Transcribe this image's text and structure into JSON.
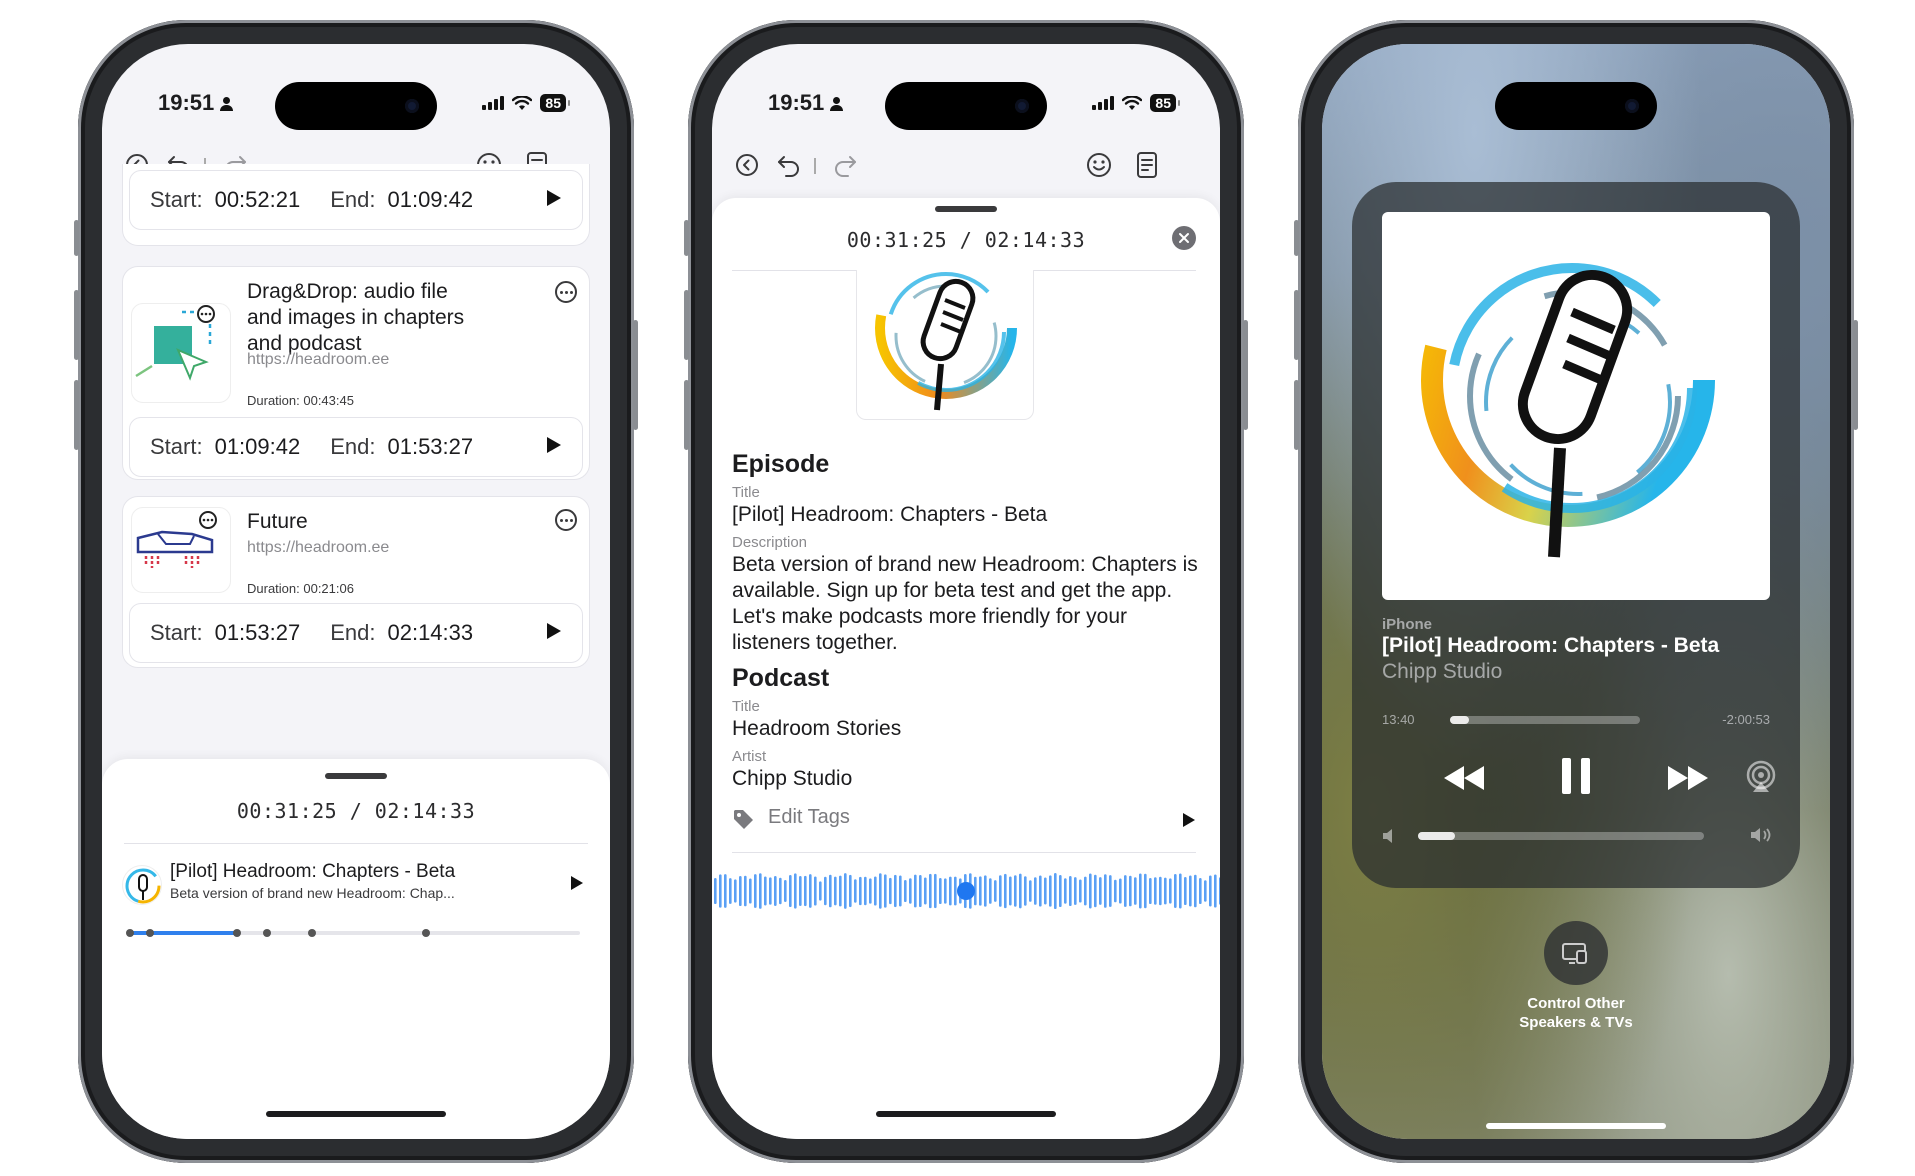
{
  "status": {
    "time": "19:51",
    "battery": "85"
  },
  "phone1": {
    "chapters": [
      {
        "start_label": "Start:",
        "start": "00:52:21",
        "end_label": "End:",
        "end": "01:09:42"
      },
      {
        "title": "Drag&Drop:  audio file and images in chapters and podcast",
        "url": "https://headroom.ee",
        "duration": "Duration: 00:43:45",
        "start_label": "Start:",
        "start": "01:09:42",
        "end_label": "End:",
        "end": "01:53:27"
      },
      {
        "title": "Future",
        "url": "https://headroom.ee",
        "duration": "Duration: 00:21:06",
        "start_label": "Start:",
        "start": "01:53:27",
        "end_label": "End:",
        "end": "02:14:33"
      }
    ],
    "fab_label": "+",
    "player": {
      "timecode": "00:31:25 / 02:14:33",
      "title": "[Pilot] Headroom: Chapters - Beta",
      "subtitle": "Beta version of brand new Headroom: Chap...",
      "progress": 0.24
    }
  },
  "phone2": {
    "timecode": "00:31:25 / 02:14:33",
    "episode": {
      "heading": "Episode",
      "title_label": "Title",
      "title": "[Pilot] Headroom: Chapters - Beta",
      "description_label": "Description",
      "description": "Beta version of brand new Headroom: Chapters is available. Sign up for beta test and get the app. Let's make podcasts more friendly for your listeners together."
    },
    "podcast": {
      "heading": "Podcast",
      "title_label": "Title",
      "title": "Headroom Stories",
      "artist_label": "Artist",
      "artist": "Chipp Studio"
    },
    "edit_tags": "Edit Tags",
    "waveform_position": 0.5
  },
  "phone3": {
    "device": "iPhone",
    "title": "[Pilot] Headroom: Chapters - Beta",
    "artist": "Chipp Studio",
    "elapsed": "13:40",
    "remaining": "-2:00:53",
    "progress": 0.1,
    "volume": 0.13,
    "control_label": "Control Other Speakers & TVs"
  },
  "colors": {
    "accent": "#3e8bef",
    "waveform": "#5aa0f5"
  },
  "icons": [
    "back-circle-icon",
    "undo-icon",
    "redo-icon",
    "smiley-icon",
    "document-icon",
    "play-icon",
    "more-icon",
    "tag-icon",
    "close-icon",
    "rewind-icon",
    "pause-icon",
    "fast-forward-icon",
    "airplay-icon",
    "volume-low-icon",
    "volume-high-icon",
    "screen-mirror-icon"
  ]
}
